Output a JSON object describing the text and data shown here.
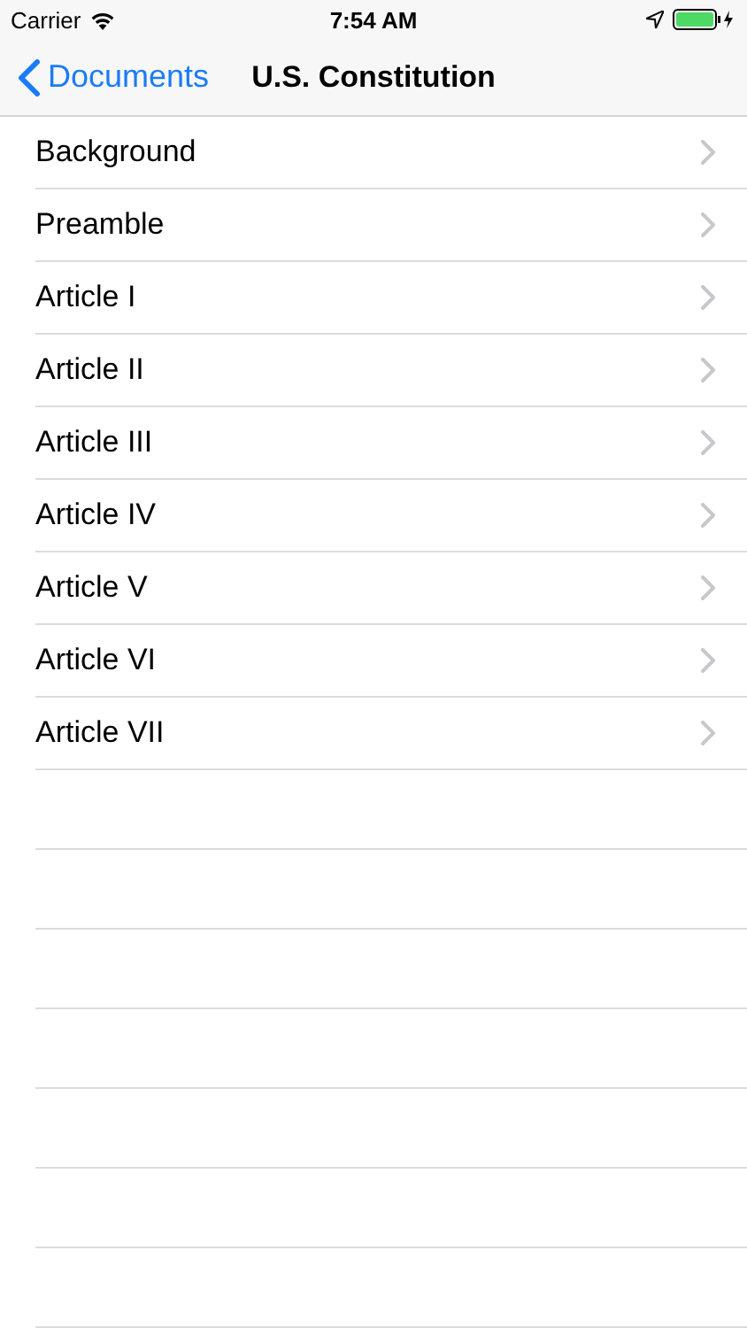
{
  "status_bar": {
    "carrier": "Carrier",
    "time": "7:54 AM"
  },
  "nav": {
    "back": "Documents",
    "title": "U.S. Constitution"
  },
  "items": [
    {
      "label": "Background"
    },
    {
      "label": "Preamble"
    },
    {
      "label": "Article I"
    },
    {
      "label": "Article II"
    },
    {
      "label": "Article III"
    },
    {
      "label": "Article IV"
    },
    {
      "label": "Article V"
    },
    {
      "label": "Article VI"
    },
    {
      "label": "Article VII"
    }
  ]
}
